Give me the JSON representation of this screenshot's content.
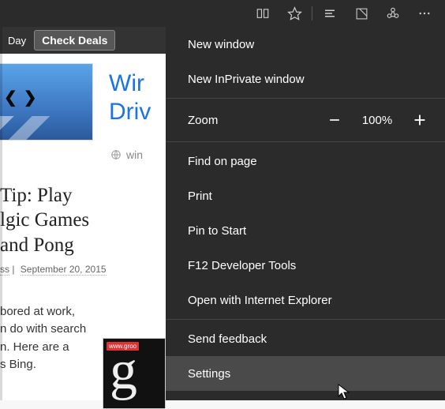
{
  "topbar": {
    "icons": [
      "reading-list",
      "favorite",
      "hub",
      "note",
      "share",
      "more"
    ]
  },
  "banner": {
    "day_label": "Day",
    "deals_button": "Check Deals"
  },
  "hero": {
    "link_line1": "Wir",
    "link_line2": "Driv",
    "site_partial": "win"
  },
  "article": {
    "title_line1": "Tip: Play",
    "title_line2": "lgic Games",
    "title_line3": " and Pong",
    "author_suffix": "ss",
    "date": "September 20, 2015",
    "excerpt_line1": "bored at work,",
    "excerpt_line2": "n do with search",
    "excerpt_line3": "n. Here are a",
    "excerpt_line4": "s Bing."
  },
  "sidecard": {
    "tab": "www.groo",
    "glyph": "g"
  },
  "menu": {
    "new_window": "New window",
    "new_inprivate": "New InPrivate window",
    "zoom_label": "Zoom",
    "zoom_value": "100%",
    "find": "Find on page",
    "print": "Print",
    "pin": "Pin to Start",
    "devtools": "F12 Developer Tools",
    "open_ie": "Open with Internet Explorer",
    "feedback": "Send feedback",
    "settings": "Settings"
  }
}
